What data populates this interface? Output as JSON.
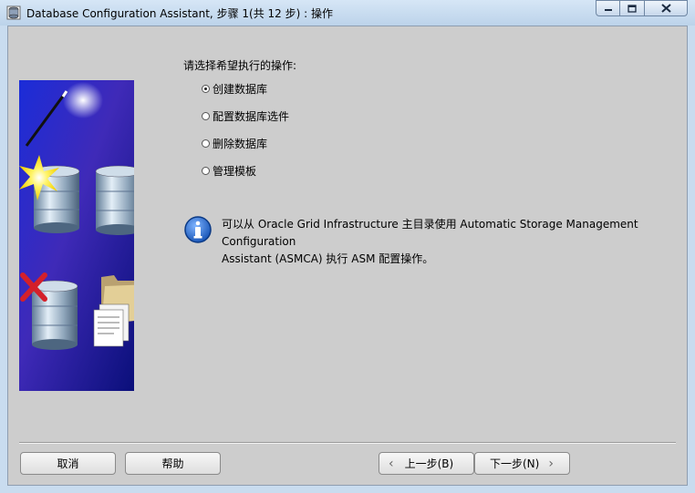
{
  "window": {
    "title": "Database Configuration Assistant, 步骤 1(共 12 步) : 操作",
    "minimize_icon": "minimize-icon",
    "maximize_icon": "maximize-icon",
    "close_icon": "close-icon"
  },
  "main": {
    "prompt": "请选择希望执行的操作:",
    "options": [
      {
        "label": "创建数据库",
        "checked": true
      },
      {
        "label": "配置数据库选件",
        "checked": false
      },
      {
        "label": "删除数据库",
        "checked": false
      },
      {
        "label": "管理模板",
        "checked": false
      }
    ],
    "info_line1": "可以从 Oracle Grid Infrastructure 主目录使用 Automatic Storage Management Configuration",
    "info_line2": "Assistant (ASMCA) 执行 ASM 配置操作。"
  },
  "footer": {
    "cancel_label": "取消",
    "help_label": "帮助",
    "back_label": "上一步(B)",
    "next_label": "下一步(N)"
  },
  "colors": {
    "accent": "#1a57b8",
    "check_red": "#d4202a"
  }
}
